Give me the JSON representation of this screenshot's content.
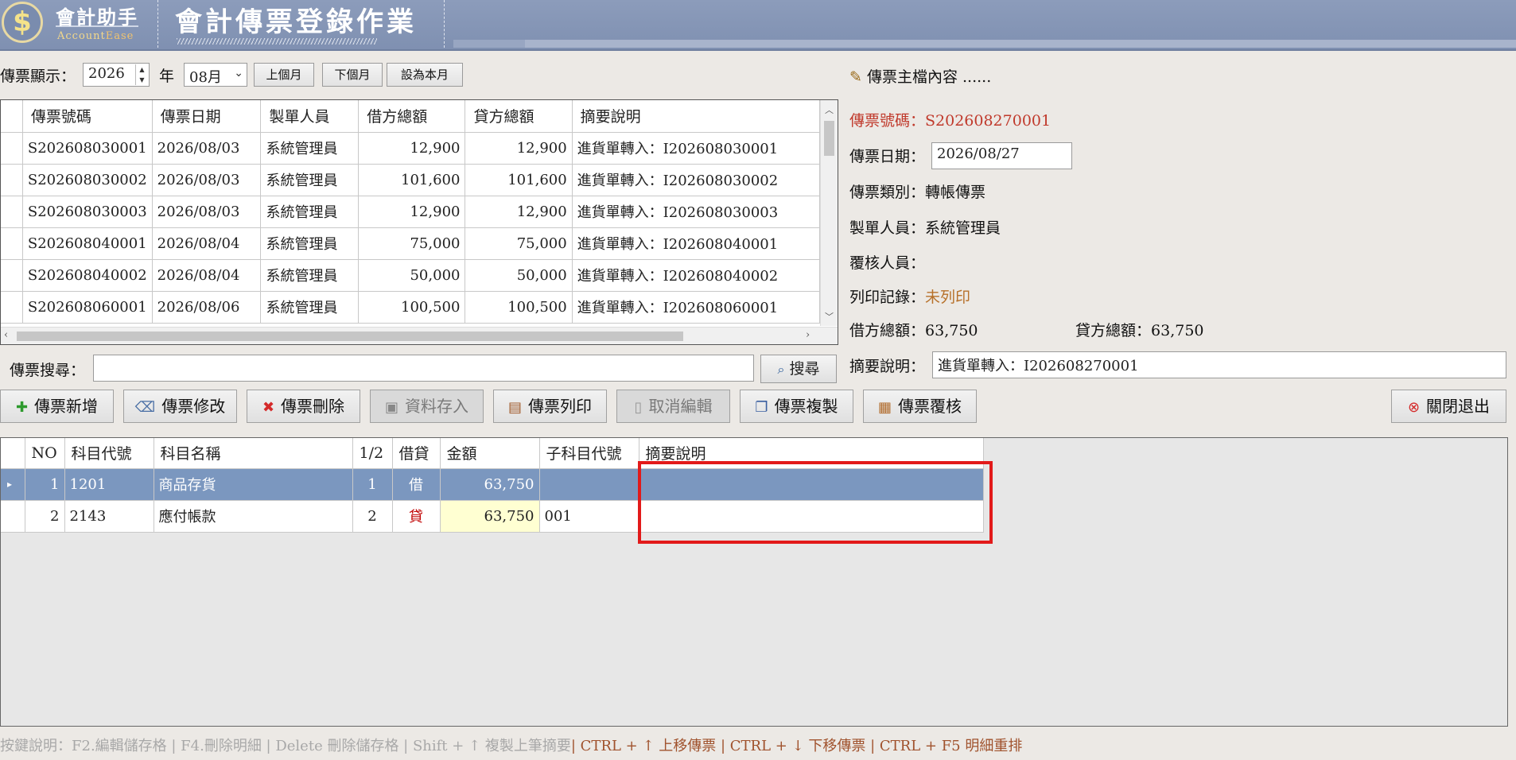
{
  "header": {
    "logo_symbol": "$",
    "brand_cn": "會計助手",
    "brand_en_a": "Account",
    "brand_en_b": "Ease",
    "title": "會計傳票登錄作業"
  },
  "filter": {
    "display_label": "傳票顯示：",
    "year_value": "2026",
    "year_label": "年",
    "month_value": "08月",
    "prev_month": "上個月",
    "next_month": "下個月",
    "set_this_month": "設為本月"
  },
  "voucher_list": {
    "columns": [
      "傳票號碼",
      "傳票日期",
      "製單人員",
      "借方總額",
      "貸方總額",
      "摘要說明"
    ],
    "rows": [
      [
        "S202608030001",
        "2026/08/03",
        "系統管理員",
        "12,900",
        "12,900",
        "進貨單轉入：I202608030001"
      ],
      [
        "S202608030002",
        "2026/08/03",
        "系統管理員",
        "101,600",
        "101,600",
        "進貨單轉入：I202608030002"
      ],
      [
        "S202608030003",
        "2026/08/03",
        "系統管理員",
        "12,900",
        "12,900",
        "進貨單轉入：I202608030003"
      ],
      [
        "S202608040001",
        "2026/08/04",
        "系統管理員",
        "75,000",
        "75,000",
        "進貨單轉入：I202608040001"
      ],
      [
        "S202608040002",
        "2026/08/04",
        "系統管理員",
        "50,000",
        "50,000",
        "進貨單轉入：I202608040002"
      ],
      [
        "S202608060001",
        "2026/08/06",
        "系統管理員",
        "100,500",
        "100,500",
        "進貨單轉入：I202608060001"
      ]
    ]
  },
  "search": {
    "label": "傳票搜尋：",
    "value": "",
    "button": "搜尋"
  },
  "actions": {
    "add": "傳票新增",
    "edit": "傳票修改",
    "delete": "傳票刪除",
    "save": "資料存入",
    "print": "傳票列印",
    "cancel": "取消編輯",
    "copy": "傳票複製",
    "review": "傳票覆核",
    "close": "關閉退出"
  },
  "master": {
    "section_title": "傳票主檔內容 ......",
    "number_label": "傳票號碼：",
    "number_value": "S202608270001",
    "date_label": "傳票日期：",
    "date_value": "2026/08/27",
    "type_label": "傳票類別：",
    "type_value": "轉帳傳票",
    "maker_label": "製單人員：",
    "maker_value": "系統管理員",
    "reviewer_label": "覆核人員：",
    "reviewer_value": "",
    "print_label": "列印記錄：",
    "print_value": "未列印",
    "debit_label": "借方總額：",
    "debit_value": "63,750",
    "credit_label": "貸方總額：",
    "credit_value": "63,750",
    "memo_label": "摘要說明：",
    "memo_value": "進貨單轉入：I202608270001"
  },
  "detail": {
    "columns": [
      "NO",
      "科目代號",
      "科目名稱",
      "1/2",
      "借貸",
      "金額",
      "子科目代號",
      "摘要說明"
    ],
    "rows": [
      {
        "marker": "▸",
        "no": "1",
        "code": "1201",
        "name": "商品存貨",
        "dc_num": "1",
        "dc": "借",
        "amount": "63,750",
        "sub": "",
        "memo": ""
      },
      {
        "marker": "",
        "no": "2",
        "code": "2143",
        "name": "應付帳款",
        "dc_num": "2",
        "dc": "貸",
        "amount": "63,750",
        "sub": "001",
        "memo": ""
      }
    ]
  },
  "hotkeys": {
    "gray": "按鍵說明：F2.編輯儲存格 | F4.刪除明細 | Delete 刪除儲存格 | Shift + ↑ 複製上筆摘要",
    "brown": "| CTRL + ↑ 上移傳票 | CTRL + ↓ 下移傳票 | CTRL + F5 明細重排"
  },
  "colors": {
    "header_bg": "#8C9CBB",
    "selected_row": "#7B97BF",
    "highlight_box": "#E21A1A",
    "label_red": "#C0392B",
    "label_brown": "#B7712A"
  }
}
